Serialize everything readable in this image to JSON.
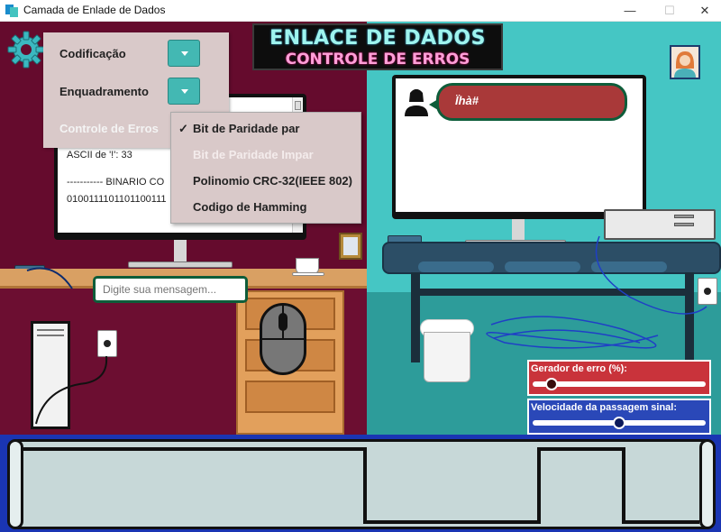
{
  "window": {
    "title": "Camada de Enlade de Dados",
    "min": "—",
    "max": "☐",
    "close": "✕"
  },
  "banner": {
    "title": "ENLACE DE DADOS",
    "subtitle": "CONTROLE DE ERROS"
  },
  "settings_menu": {
    "codificacao": "Codificação",
    "enquadramento": "Enquadramento",
    "controle": "Controle de Erros"
  },
  "options": [
    {
      "label": "Bit de Paridade par",
      "checked": true,
      "enabled": true
    },
    {
      "label": "Bit de Paridade Impar",
      "checked": false,
      "enabled": false
    },
    {
      "label": "Polinomio CRC-32(IEEE 802)",
      "checked": false,
      "enabled": true
    },
    {
      "label": "Codigo de Hamming",
      "checked": false,
      "enabled": true
    }
  ],
  "check_mark": "✓",
  "console": {
    "ascii_line": "ASCII de '!': 33",
    "binario_line": "----------- BINARIO CO",
    "bits_line": "0100111101101100111"
  },
  "message_input": {
    "placeholder": "Digite sua mensagem..."
  },
  "chat": {
    "received": "Ïhà#"
  },
  "sliders": {
    "error_label": "Gerador de erro (%):",
    "error_value_fraction": 0.08,
    "speed_label": "Velocidade da passagem sinal:",
    "speed_value_fraction": 0.5
  },
  "colors": {
    "left_bg": "#650b2d",
    "right_bg": "#3ec3c3",
    "accent_teal": "#43b8b3",
    "chat_bubble": "#a93939",
    "strip_blue": "#1a35b3"
  },
  "icons": {
    "gear": "gear-icon",
    "person": "person-icon",
    "avatar": "avatar-icon"
  }
}
